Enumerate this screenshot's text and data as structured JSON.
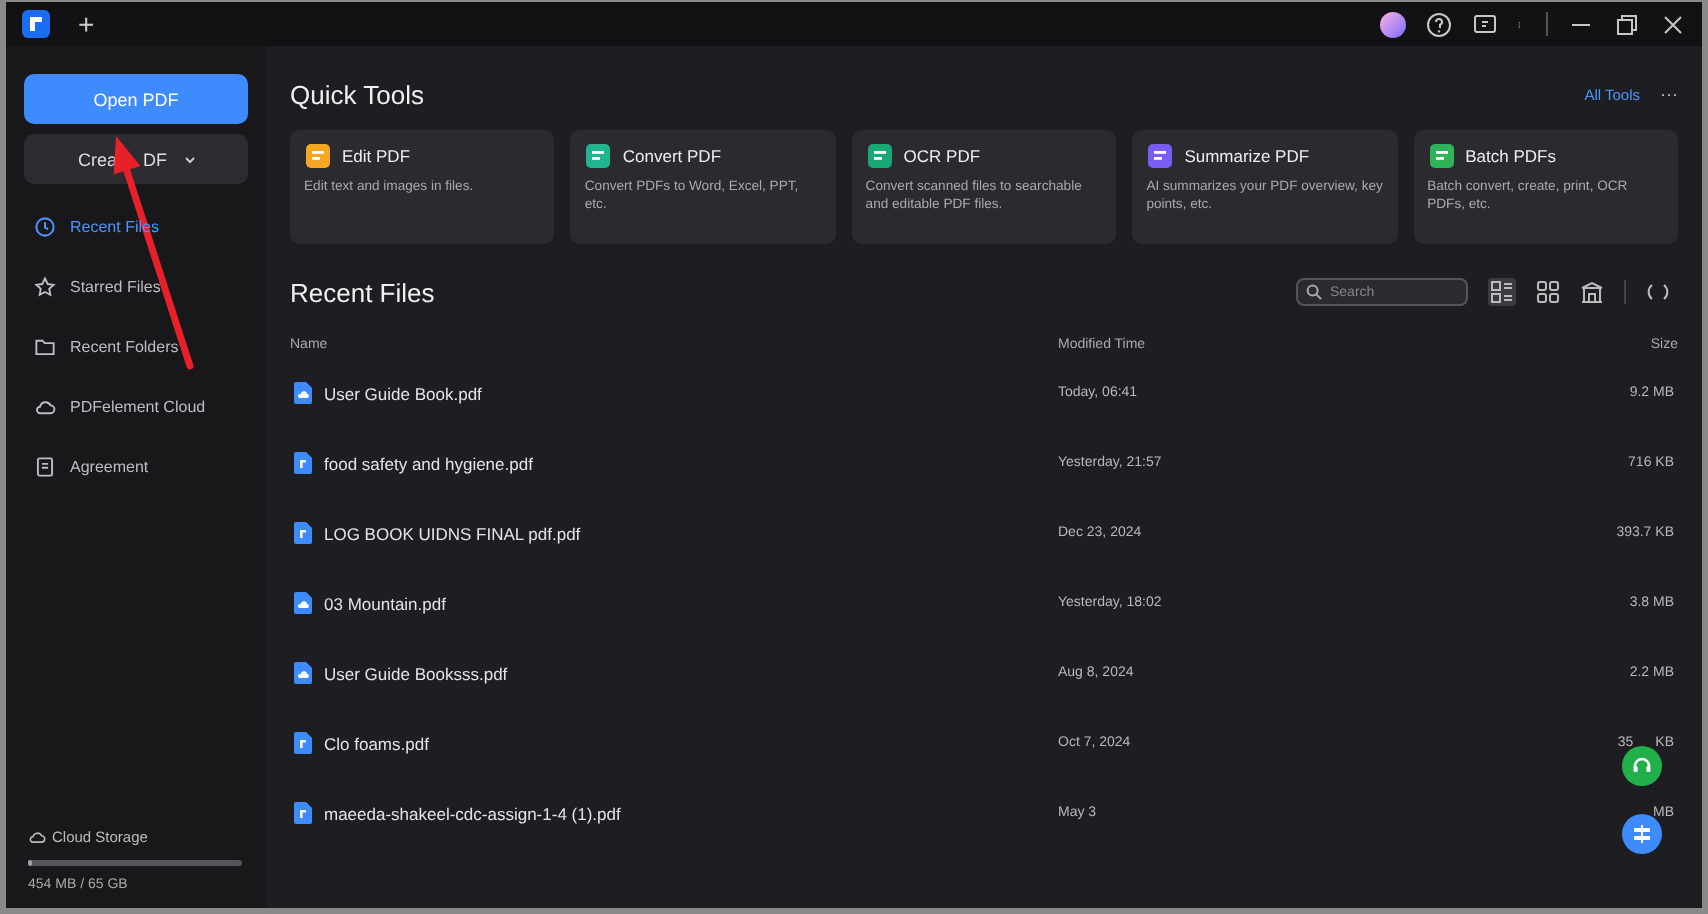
{
  "titlebar": {
    "tab_add": "+"
  },
  "sidebar": {
    "primary_button": "Open PDF",
    "secondary_button_parts": [
      "Crea",
      "DF"
    ],
    "items": [
      {
        "label": "Recent Files",
        "selected": true
      },
      {
        "label": "Starred Files",
        "selected": false
      },
      {
        "label": "Recent Folders",
        "selected": false
      },
      {
        "label": "PDFelement Cloud",
        "selected": false
      },
      {
        "label": "Agreement",
        "selected": false
      }
    ],
    "storage": {
      "label": "Cloud Storage",
      "level": 0.02,
      "reading": "454 MB / 65 GB"
    }
  },
  "quick_tools": {
    "title": "Quick Tools",
    "link": "All Tools",
    "more": "···",
    "tools": [
      {
        "title": "Edit PDF",
        "description": "Edit text and images in files.",
        "color": "#f5a623"
      },
      {
        "title": "Convert PDF",
        "description": "Convert PDFs to Word, Excel, PPT, etc.",
        "color": "#1fb58f"
      },
      {
        "title": "OCR PDF",
        "description": "Convert scanned files to searchable and editable PDF files.",
        "color": "#19a974"
      },
      {
        "title": "Summarize PDF",
        "description": "AI summarizes your PDF overview, key points, etc.",
        "color": "#7c5cf6"
      },
      {
        "title": "Batch PDFs",
        "description": "Batch convert, create, print, OCR PDFs, etc.",
        "color": "#2fb35a"
      }
    ]
  },
  "recent_files": {
    "title": "Recent Files",
    "search": {
      "placeholder": "Search"
    },
    "columns": [
      "Name",
      "Modified Time",
      "Size"
    ],
    "rows": [
      {
        "name": "User Guide Book.pdf",
        "modified": "Today, 06:41",
        "size": "9.2 MB",
        "kind": "cloud"
      },
      {
        "name": "food safety and hygiene.pdf",
        "modified": "Yesterday, 21:57",
        "size": "716 KB",
        "kind": "local"
      },
      {
        "name": "LOG BOOK UIDNS FINAL pdf.pdf",
        "modified": "Dec 23, 2024",
        "size": "393.7 KB",
        "kind": "local"
      },
      {
        "name": "03 Mountain.pdf",
        "modified": "Yesterday, 18:02",
        "size": "3.8 MB",
        "kind": "cloud"
      },
      {
        "name": "User Guide Booksss.pdf",
        "modified": "Aug 8, 2024",
        "size": "2.2 MB",
        "kind": "cloud"
      },
      {
        "name": "Clo foams.pdf",
        "modified": "Oct 7, 2024",
        "size_parts": [
          "35",
          "KB"
        ],
        "kind": "local"
      },
      {
        "name": "maeeda-shakeel-cdc-assign-1-4 (1).pdf",
        "modified": "May 3",
        "size_parts": [
          "MB"
        ],
        "kind": "local"
      }
    ]
  }
}
